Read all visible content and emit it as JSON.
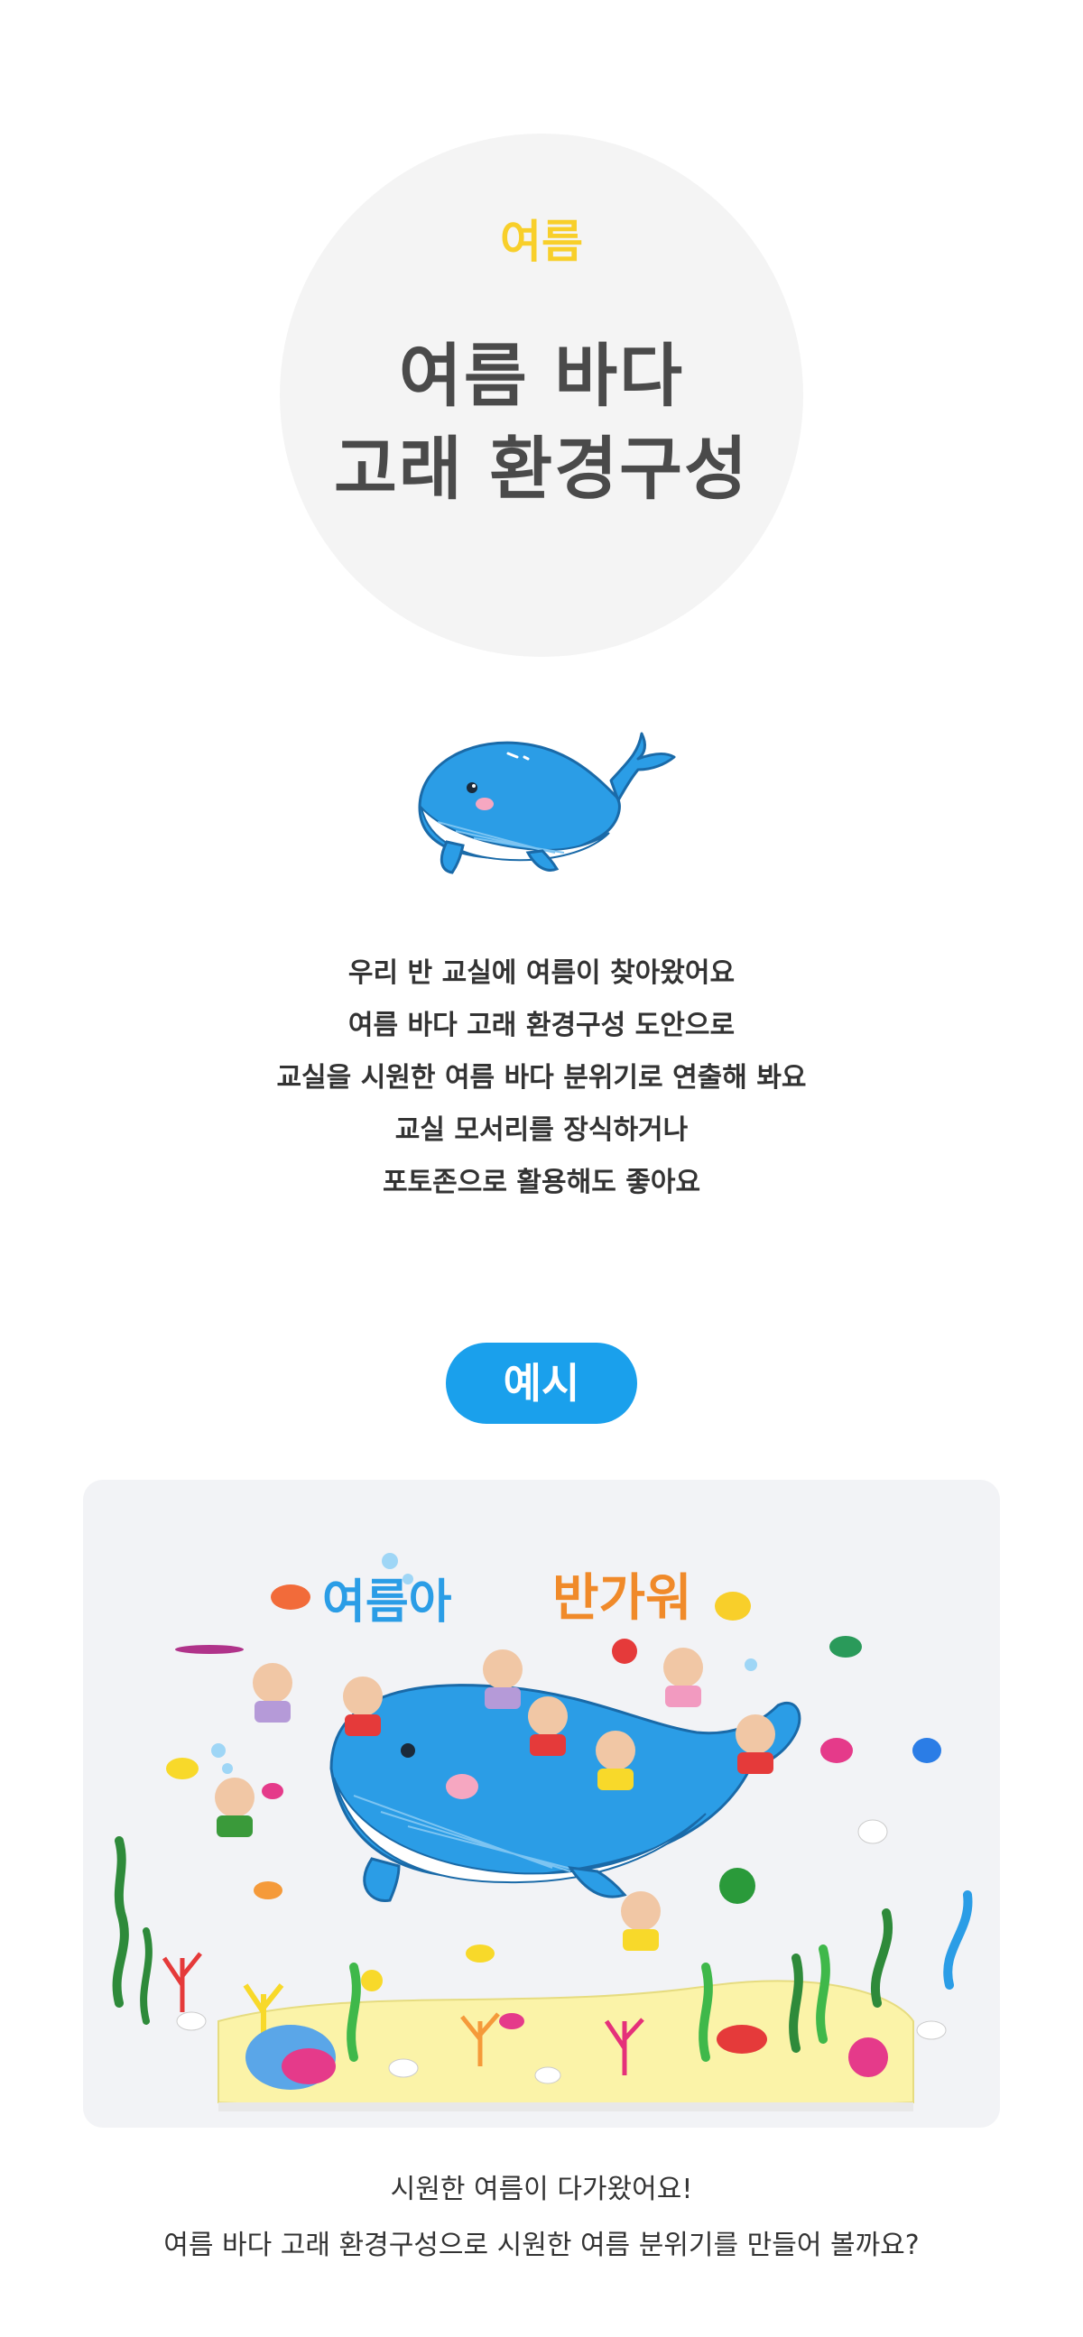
{
  "hero": {
    "season": "여름",
    "title_line1": "여름 바다",
    "title_line2": "고래 환경구성"
  },
  "icons": {
    "whale": "whale-icon"
  },
  "intro": {
    "lines": [
      "우리 반 교실에 여름이 찾아왔어요",
      "여름 바다 고래 환경구성 도안으로",
      "교실을 시원한 여름 바다 분위기로 연출해 봐요",
      "교실 모서리를 장식하거나",
      "포토존으로 활용해도 좋아요"
    ]
  },
  "example": {
    "label": "예시",
    "banner_left": "여름아",
    "banner_right": "반가워"
  },
  "caption": {
    "line1": "시원한 여름이 다가왔어요!",
    "line2": "여름 바다 고래 환경구성으로 시원한 여름 분위기를 만들어 볼까요?"
  },
  "colors": {
    "accent_yellow": "#f8cf2a",
    "accent_blue": "#1aa0ec",
    "title_gray": "#4a4a4a",
    "circle_bg": "#f4f4f4",
    "whale_blue": "#2b9de6"
  }
}
